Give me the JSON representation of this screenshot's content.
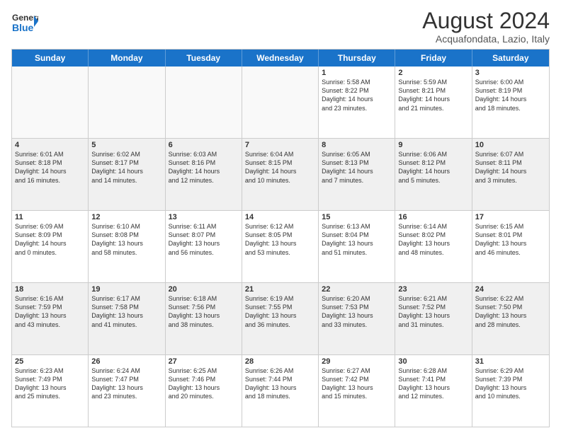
{
  "header": {
    "logo_line1": "General",
    "logo_line2": "Blue",
    "main_title": "August 2024",
    "subtitle": "Acquafondata, Lazio, Italy"
  },
  "days_of_week": [
    "Sunday",
    "Monday",
    "Tuesday",
    "Wednesday",
    "Thursday",
    "Friday",
    "Saturday"
  ],
  "weeks": [
    [
      {
        "day": "",
        "empty": true
      },
      {
        "day": "",
        "empty": true
      },
      {
        "day": "",
        "empty": true
      },
      {
        "day": "",
        "empty": true
      },
      {
        "day": "1",
        "info": "Sunrise: 5:58 AM\nSunset: 8:22 PM\nDaylight: 14 hours\nand 23 minutes."
      },
      {
        "day": "2",
        "info": "Sunrise: 5:59 AM\nSunset: 8:21 PM\nDaylight: 14 hours\nand 21 minutes."
      },
      {
        "day": "3",
        "info": "Sunrise: 6:00 AM\nSunset: 8:19 PM\nDaylight: 14 hours\nand 18 minutes."
      }
    ],
    [
      {
        "day": "4",
        "info": "Sunrise: 6:01 AM\nSunset: 8:18 PM\nDaylight: 14 hours\nand 16 minutes."
      },
      {
        "day": "5",
        "info": "Sunrise: 6:02 AM\nSunset: 8:17 PM\nDaylight: 14 hours\nand 14 minutes."
      },
      {
        "day": "6",
        "info": "Sunrise: 6:03 AM\nSunset: 8:16 PM\nDaylight: 14 hours\nand 12 minutes."
      },
      {
        "day": "7",
        "info": "Sunrise: 6:04 AM\nSunset: 8:15 PM\nDaylight: 14 hours\nand 10 minutes."
      },
      {
        "day": "8",
        "info": "Sunrise: 6:05 AM\nSunset: 8:13 PM\nDaylight: 14 hours\nand 7 minutes."
      },
      {
        "day": "9",
        "info": "Sunrise: 6:06 AM\nSunset: 8:12 PM\nDaylight: 14 hours\nand 5 minutes."
      },
      {
        "day": "10",
        "info": "Sunrise: 6:07 AM\nSunset: 8:11 PM\nDaylight: 14 hours\nand 3 minutes."
      }
    ],
    [
      {
        "day": "11",
        "info": "Sunrise: 6:09 AM\nSunset: 8:09 PM\nDaylight: 14 hours\nand 0 minutes."
      },
      {
        "day": "12",
        "info": "Sunrise: 6:10 AM\nSunset: 8:08 PM\nDaylight: 13 hours\nand 58 minutes."
      },
      {
        "day": "13",
        "info": "Sunrise: 6:11 AM\nSunset: 8:07 PM\nDaylight: 13 hours\nand 56 minutes."
      },
      {
        "day": "14",
        "info": "Sunrise: 6:12 AM\nSunset: 8:05 PM\nDaylight: 13 hours\nand 53 minutes."
      },
      {
        "day": "15",
        "info": "Sunrise: 6:13 AM\nSunset: 8:04 PM\nDaylight: 13 hours\nand 51 minutes."
      },
      {
        "day": "16",
        "info": "Sunrise: 6:14 AM\nSunset: 8:02 PM\nDaylight: 13 hours\nand 48 minutes."
      },
      {
        "day": "17",
        "info": "Sunrise: 6:15 AM\nSunset: 8:01 PM\nDaylight: 13 hours\nand 46 minutes."
      }
    ],
    [
      {
        "day": "18",
        "info": "Sunrise: 6:16 AM\nSunset: 7:59 PM\nDaylight: 13 hours\nand 43 minutes."
      },
      {
        "day": "19",
        "info": "Sunrise: 6:17 AM\nSunset: 7:58 PM\nDaylight: 13 hours\nand 41 minutes."
      },
      {
        "day": "20",
        "info": "Sunrise: 6:18 AM\nSunset: 7:56 PM\nDaylight: 13 hours\nand 38 minutes."
      },
      {
        "day": "21",
        "info": "Sunrise: 6:19 AM\nSunset: 7:55 PM\nDaylight: 13 hours\nand 36 minutes."
      },
      {
        "day": "22",
        "info": "Sunrise: 6:20 AM\nSunset: 7:53 PM\nDaylight: 13 hours\nand 33 minutes."
      },
      {
        "day": "23",
        "info": "Sunrise: 6:21 AM\nSunset: 7:52 PM\nDaylight: 13 hours\nand 31 minutes."
      },
      {
        "day": "24",
        "info": "Sunrise: 6:22 AM\nSunset: 7:50 PM\nDaylight: 13 hours\nand 28 minutes."
      }
    ],
    [
      {
        "day": "25",
        "info": "Sunrise: 6:23 AM\nSunset: 7:49 PM\nDaylight: 13 hours\nand 25 minutes."
      },
      {
        "day": "26",
        "info": "Sunrise: 6:24 AM\nSunset: 7:47 PM\nDaylight: 13 hours\nand 23 minutes."
      },
      {
        "day": "27",
        "info": "Sunrise: 6:25 AM\nSunset: 7:46 PM\nDaylight: 13 hours\nand 20 minutes."
      },
      {
        "day": "28",
        "info": "Sunrise: 6:26 AM\nSunset: 7:44 PM\nDaylight: 13 hours\nand 18 minutes."
      },
      {
        "day": "29",
        "info": "Sunrise: 6:27 AM\nSunset: 7:42 PM\nDaylight: 13 hours\nand 15 minutes."
      },
      {
        "day": "30",
        "info": "Sunrise: 6:28 AM\nSunset: 7:41 PM\nDaylight: 13 hours\nand 12 minutes."
      },
      {
        "day": "31",
        "info": "Sunrise: 6:29 AM\nSunset: 7:39 PM\nDaylight: 13 hours\nand 10 minutes."
      }
    ]
  ]
}
